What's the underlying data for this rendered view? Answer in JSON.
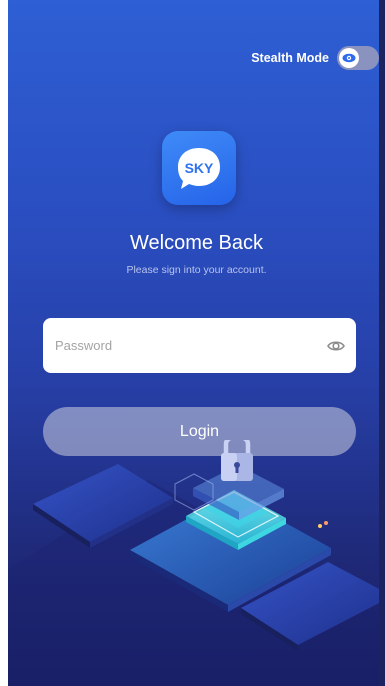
{
  "header": {
    "stealth_label": "Stealth Mode",
    "stealth_enabled": true
  },
  "logo": {
    "text": "SKY"
  },
  "welcome": {
    "title": "Welcome Back",
    "subtitle": "Please sign into your account."
  },
  "form": {
    "password_placeholder": "Password",
    "password_value": "",
    "login_label": "Login"
  },
  "icons": {
    "stealth_toggle_icon": "eye-icon",
    "password_visibility_icon": "eye-icon",
    "illustration": "lock-icon"
  },
  "colors": {
    "background_top": "#2e5fd4",
    "background_bottom": "#171d5e",
    "logo_blue": "#2f72f0",
    "login_button": "#c8cadb",
    "accent_cyan": "#4fe3e6"
  }
}
